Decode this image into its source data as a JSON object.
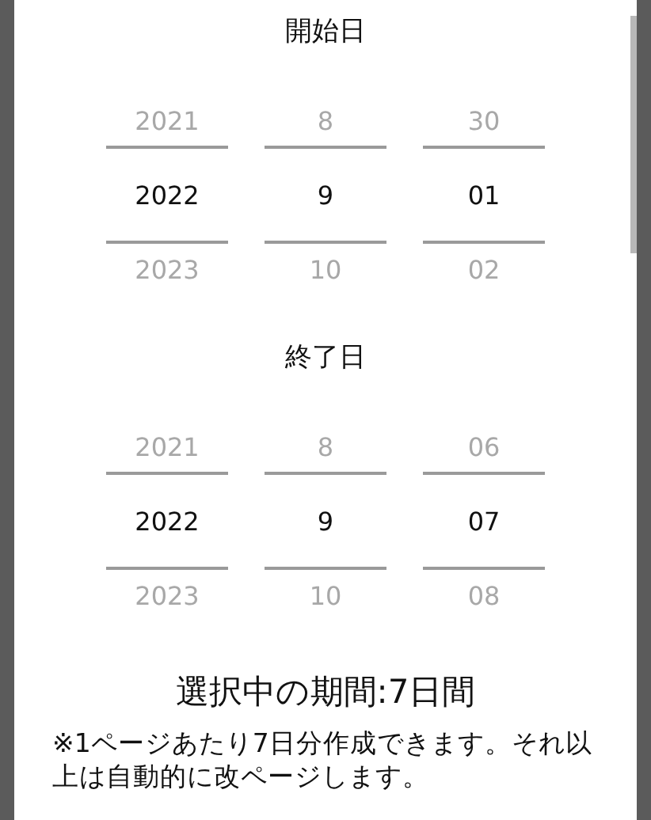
{
  "sections": [
    {
      "title": "開始日",
      "pickers": [
        {
          "items": [
            {
              "text": "2021",
              "selected": false
            },
            {
              "text": "2022",
              "selected": true
            },
            {
              "text": "2023",
              "selected": false
            }
          ]
        },
        {
          "items": [
            {
              "text": "8",
              "selected": false
            },
            {
              "text": "9",
              "selected": true
            },
            {
              "text": "10",
              "selected": false
            }
          ]
        },
        {
          "items": [
            {
              "text": "30",
              "selected": false
            },
            {
              "text": "01",
              "selected": true
            },
            {
              "text": "02",
              "selected": false
            }
          ]
        }
      ]
    },
    {
      "title": "終了日",
      "pickers": [
        {
          "items": [
            {
              "text": "2021",
              "selected": false
            },
            {
              "text": "2022",
              "selected": true
            },
            {
              "text": "2023",
              "selected": false
            }
          ]
        },
        {
          "items": [
            {
              "text": "8",
              "selected": false
            },
            {
              "text": "9",
              "selected": true
            },
            {
              "text": "10",
              "selected": false
            }
          ]
        },
        {
          "items": [
            {
              "text": "06",
              "selected": false
            },
            {
              "text": "07",
              "selected": true
            },
            {
              "text": "08",
              "selected": false
            }
          ]
        }
      ]
    }
  ],
  "summary": "選択中の期間:7日間",
  "note": "※1ページあたり7日分作成できます。それ以上は自動的に改ページします。"
}
